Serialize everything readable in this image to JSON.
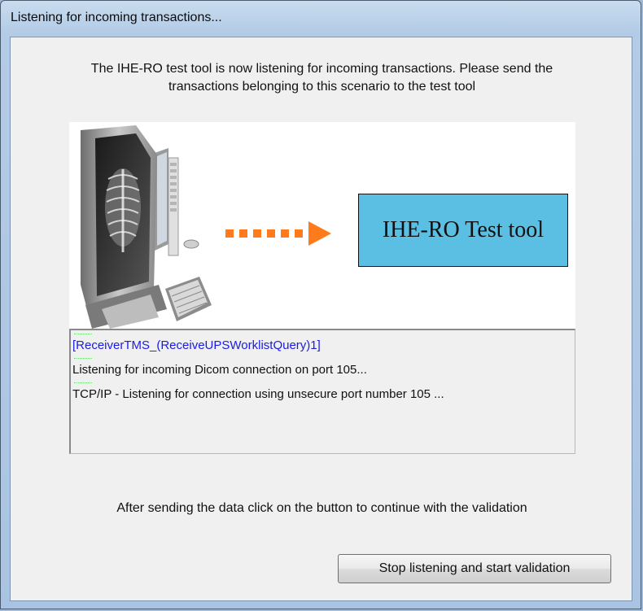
{
  "window": {
    "title": "Listening for incoming transactions..."
  },
  "intro": {
    "line1": "The IHE-RO test tool is now listening for incoming transactions. Please send the",
    "line2": "transactions belonging to this scenario to the test tool"
  },
  "illustration": {
    "target_label": "IHE-RO Test tool",
    "icons": [
      "computer-workstation-icon",
      "arrow-right-icon"
    ],
    "colors": {
      "arrow": "#ff7a1a",
      "target_box": "#5bbfe3"
    }
  },
  "log": {
    "lines": [
      {
        "text": "[ReceiverTMS_(ReceiveUPSWorklistQuery)1]",
        "color": "#1b1be6"
      },
      {
        "text": "Listening for incoming Dicom connection on port 105..."
      },
      {
        "text": "TCP/IP - Listening for connection using unsecure port number 105 ..."
      }
    ]
  },
  "instructions": {
    "after_sending": "After sending the data click on the button to continue with the validation"
  },
  "buttons": {
    "stop_label": "Stop listening and start validation"
  }
}
